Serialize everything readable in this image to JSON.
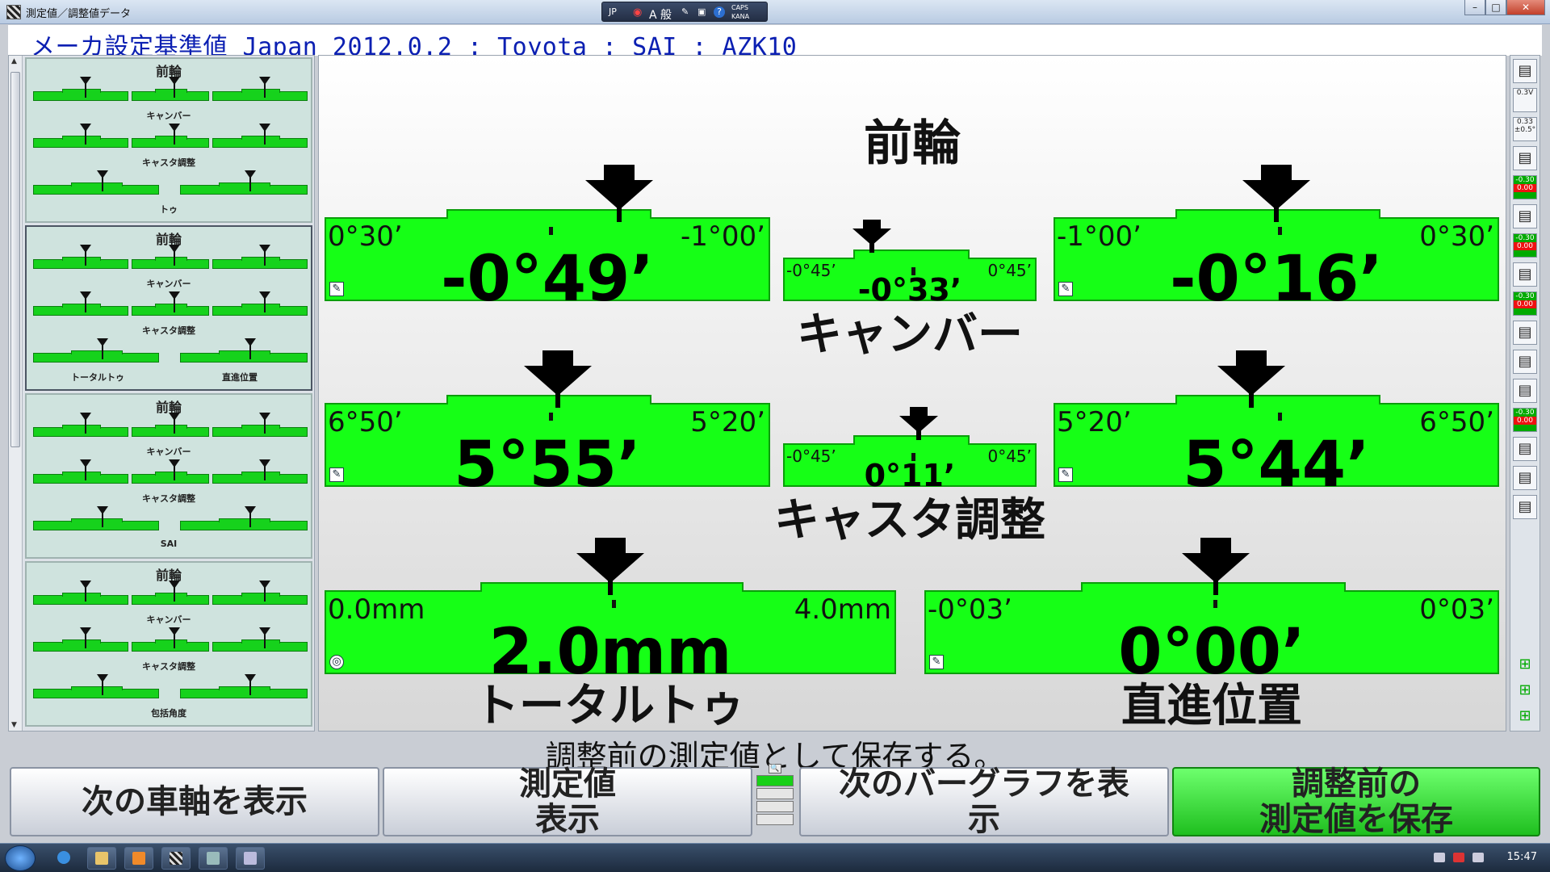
{
  "window": {
    "title": "測定値／調整値データ",
    "langbar": {
      "lang": "JP",
      "ime": "A 般",
      "caps": "CAPS",
      "kana": "KANA"
    },
    "controls": [
      "–",
      "□",
      "✕"
    ]
  },
  "header": {
    "text": "メーカ設定基準値 Japan 2012.0.2 : Toyota : SAI : AZK10"
  },
  "sidebar": {
    "cards": [
      {
        "title": "前輪",
        "labels": [
          "キャンバー",
          "キャスタ調整",
          "トゥ"
        ]
      },
      {
        "title": "前輪",
        "labels": [
          "キャンバー",
          "キャスタ調整",
          "トータルトゥ",
          "直進位置"
        ]
      },
      {
        "title": "前輪",
        "labels": [
          "キャンバー",
          "キャスタ調整",
          "SAI"
        ]
      },
      {
        "title": "前輪",
        "labels": [
          "キャンバー",
          "キャスタ調整",
          "包括角度"
        ]
      }
    ]
  },
  "main": {
    "title": "前輪",
    "camber": {
      "caption": "キャンバー",
      "left": {
        "lo": "0°30’",
        "hi": "-1°00’",
        "value": "-0°49’"
      },
      "center": {
        "lo": "-0°45’",
        "hi": "0°45’",
        "value": "-0°33’"
      },
      "right": {
        "lo": "-1°00’",
        "hi": "0°30’",
        "value": "-0°16’"
      }
    },
    "caster": {
      "caption": "キャスタ調整",
      "left": {
        "lo": "6°50’",
        "hi": "5°20’",
        "value": "5°55’"
      },
      "center": {
        "lo": "-0°45’",
        "hi": "0°45’",
        "value": "0°11’"
      },
      "right": {
        "lo": "5°20’",
        "hi": "6°50’",
        "value": "5°44’"
      }
    },
    "toe": {
      "caption": "トータルトゥ",
      "lo": "0.0mm",
      "hi": "4.0mm",
      "value": "2.0mm"
    },
    "straight": {
      "caption": "直進位置",
      "lo": "-0°03’",
      "hi": "0°03’",
      "value": "0°00’"
    }
  },
  "status": {
    "text": "調整前の測定値として保存する。"
  },
  "buttons": {
    "next_axle": "次の車軸を表示",
    "show_measured": "測定値\n表示",
    "next_bargraph": "次のバーグラフを表\n示",
    "save_before": "調整前の\n測定値を保存"
  },
  "righttoolbar": {
    "labels": [
      "0.3V",
      "0.33",
      "±0.5°",
      "-0.30",
      "0.00",
      "-0.30",
      "0.00",
      "-0.30",
      "0.00",
      "-0.30",
      "0.00"
    ]
  },
  "taskbar": {
    "clock": "15:47"
  },
  "colors": {
    "gauge_green": "#16ff16",
    "header_blue": "#0b1fb2",
    "save_button": "#1fbf1f"
  }
}
